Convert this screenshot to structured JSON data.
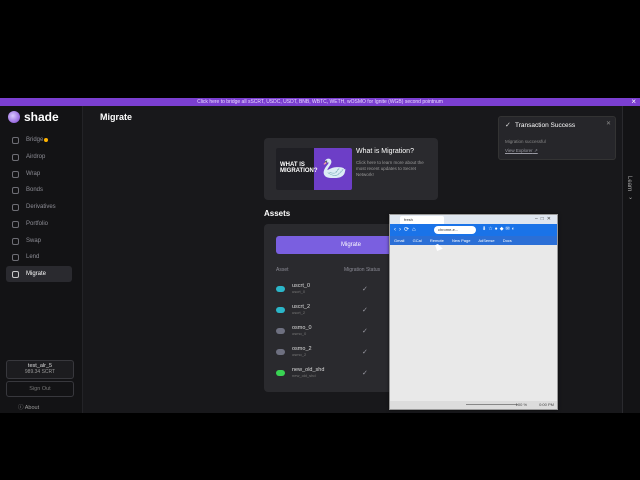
{
  "banner": {
    "text": "Click here to bridge all sSCRT, USDC, USDT, BNB, WBTC, WETH, wOSMO for Ignite (WGB) second pointnum",
    "close": "×"
  },
  "sidebar": {
    "logo": "shade",
    "items": [
      {
        "label": "Bridge"
      },
      {
        "label": "Airdrop"
      },
      {
        "label": "Wrap"
      },
      {
        "label": "Bonds"
      },
      {
        "label": "Derivatives"
      },
      {
        "label": "Portfolio"
      },
      {
        "label": "Swap"
      },
      {
        "label": "Lend"
      },
      {
        "label": "Migrate"
      }
    ],
    "wallet": {
      "name": "test_alr_5",
      "balance": "989.34 SCRT"
    },
    "signout": "Sign Out",
    "about": "About"
  },
  "main": {
    "title": "Migrate",
    "migration_card": {
      "thumb_text": "WHAT IS MIGRATION?",
      "title": "What is Migration?",
      "description": "Click here to learn more about the most recent updates to Secret Network!"
    },
    "assets_label": "Assets",
    "migrate_button": "Migrate",
    "col_asset": "Asset",
    "col_status": "Migration Status",
    "assets": [
      {
        "name": "uscrt_0",
        "sub": "uscrt_0",
        "color": "#2bb6c9"
      },
      {
        "name": "uscrt_2",
        "sub": "uscrt_2",
        "color": "#2bb6c9"
      },
      {
        "name": "osmo_0",
        "sub": "osmo_0",
        "color": "#6e7080"
      },
      {
        "name": "osmo_2",
        "sub": "osmo_2",
        "color": "#6e7080"
      },
      {
        "name": "new_old_shd",
        "sub": "new_old_shd",
        "color": "#39d353"
      }
    ]
  },
  "toast": {
    "title": "Transaction Success",
    "message": "Migration successful",
    "link": "View Explorer"
  },
  "learn_tab": {
    "label": "Learn"
  },
  "popup": {
    "tab_title": "fresh",
    "url": "chrome-e...",
    "bookmarks": [
      "Gmail",
      "GCal",
      "Remote",
      "New Page",
      "AdSense",
      "Docs"
    ],
    "zoom_label": "100 %",
    "clock": "0:00 PM"
  }
}
